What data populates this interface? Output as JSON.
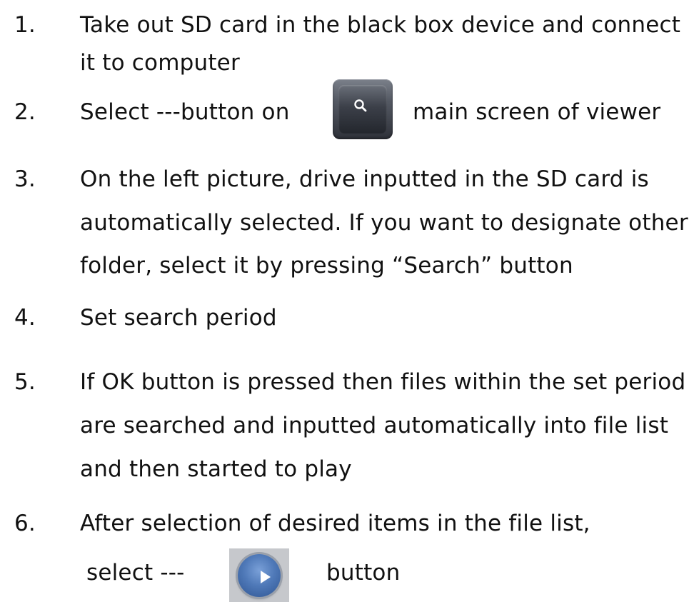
{
  "steps": [
    {
      "number": "1.",
      "lines": [
        "Take out SD card in the black box device and connect",
        "it to computer"
      ]
    },
    {
      "number": "2.",
      "lines": [
        "Select ---button on",
        "main screen of viewer"
      ]
    },
    {
      "number": "3.",
      "lines": [
        "On the left picture, drive inputted in the SD card is",
        "automatically selected. If you want to designate other",
        "folder, select it by pressing  “Search”  button"
      ]
    },
    {
      "number": "4.",
      "lines": [
        "Set search period"
      ]
    },
    {
      "number": "5.",
      "lines": [
        "If OK button is pressed then files within the set period",
        "are searched and inputted automatically into file list",
        "and then started to play"
      ]
    },
    {
      "number": "6.",
      "lines": [
        "After selection of desired items in the file list,",
        "select ---",
        "button"
      ]
    }
  ],
  "icons": {
    "search_button": "search-icon",
    "play_button": "play-icon"
  },
  "colors": {
    "text": "#111111",
    "search_button": "#3c4049",
    "play_button": "#4f79b8"
  }
}
